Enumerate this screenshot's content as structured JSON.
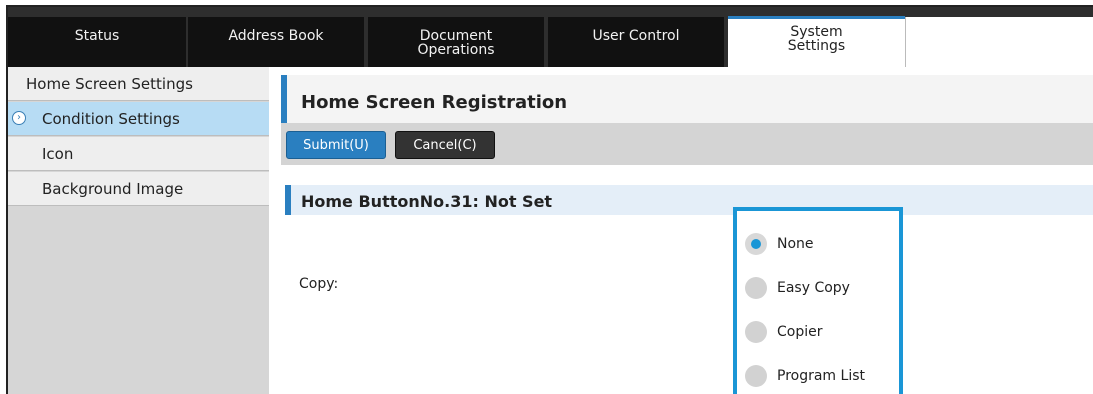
{
  "tabs": [
    {
      "label": "Status",
      "active": false
    },
    {
      "label": "Address Book",
      "active": false
    },
    {
      "label": "Document\nOperations",
      "active": false
    },
    {
      "label": "User Control",
      "active": false
    },
    {
      "label": "System\nSettings",
      "active": true
    }
  ],
  "sidebar": {
    "items": [
      {
        "label": "Home Screen Settings",
        "active": false,
        "icon": null
      },
      {
        "label": "Condition Settings",
        "active": true,
        "icon": "chevron-right-circle-icon"
      },
      {
        "label": "Icon",
        "active": false,
        "icon": null
      },
      {
        "label": "Background Image",
        "active": false,
        "icon": null
      }
    ]
  },
  "main": {
    "title": "Home Screen Registration",
    "toolbar": {
      "submit_label": "Submit(U)",
      "cancel_label": "Cancel(C)"
    },
    "section_title": "Home ButtonNo.31: Not Set",
    "field_label": "Copy:",
    "options": [
      {
        "label": "None",
        "checked": true
      },
      {
        "label": "Easy Copy",
        "checked": false
      },
      {
        "label": "Copier",
        "checked": false
      },
      {
        "label": "Program List",
        "checked": false
      }
    ]
  },
  "colors": {
    "accent": "#2a7fc0",
    "highlight": "#1a96d6",
    "sidebar_active": "#b7dcf4"
  }
}
